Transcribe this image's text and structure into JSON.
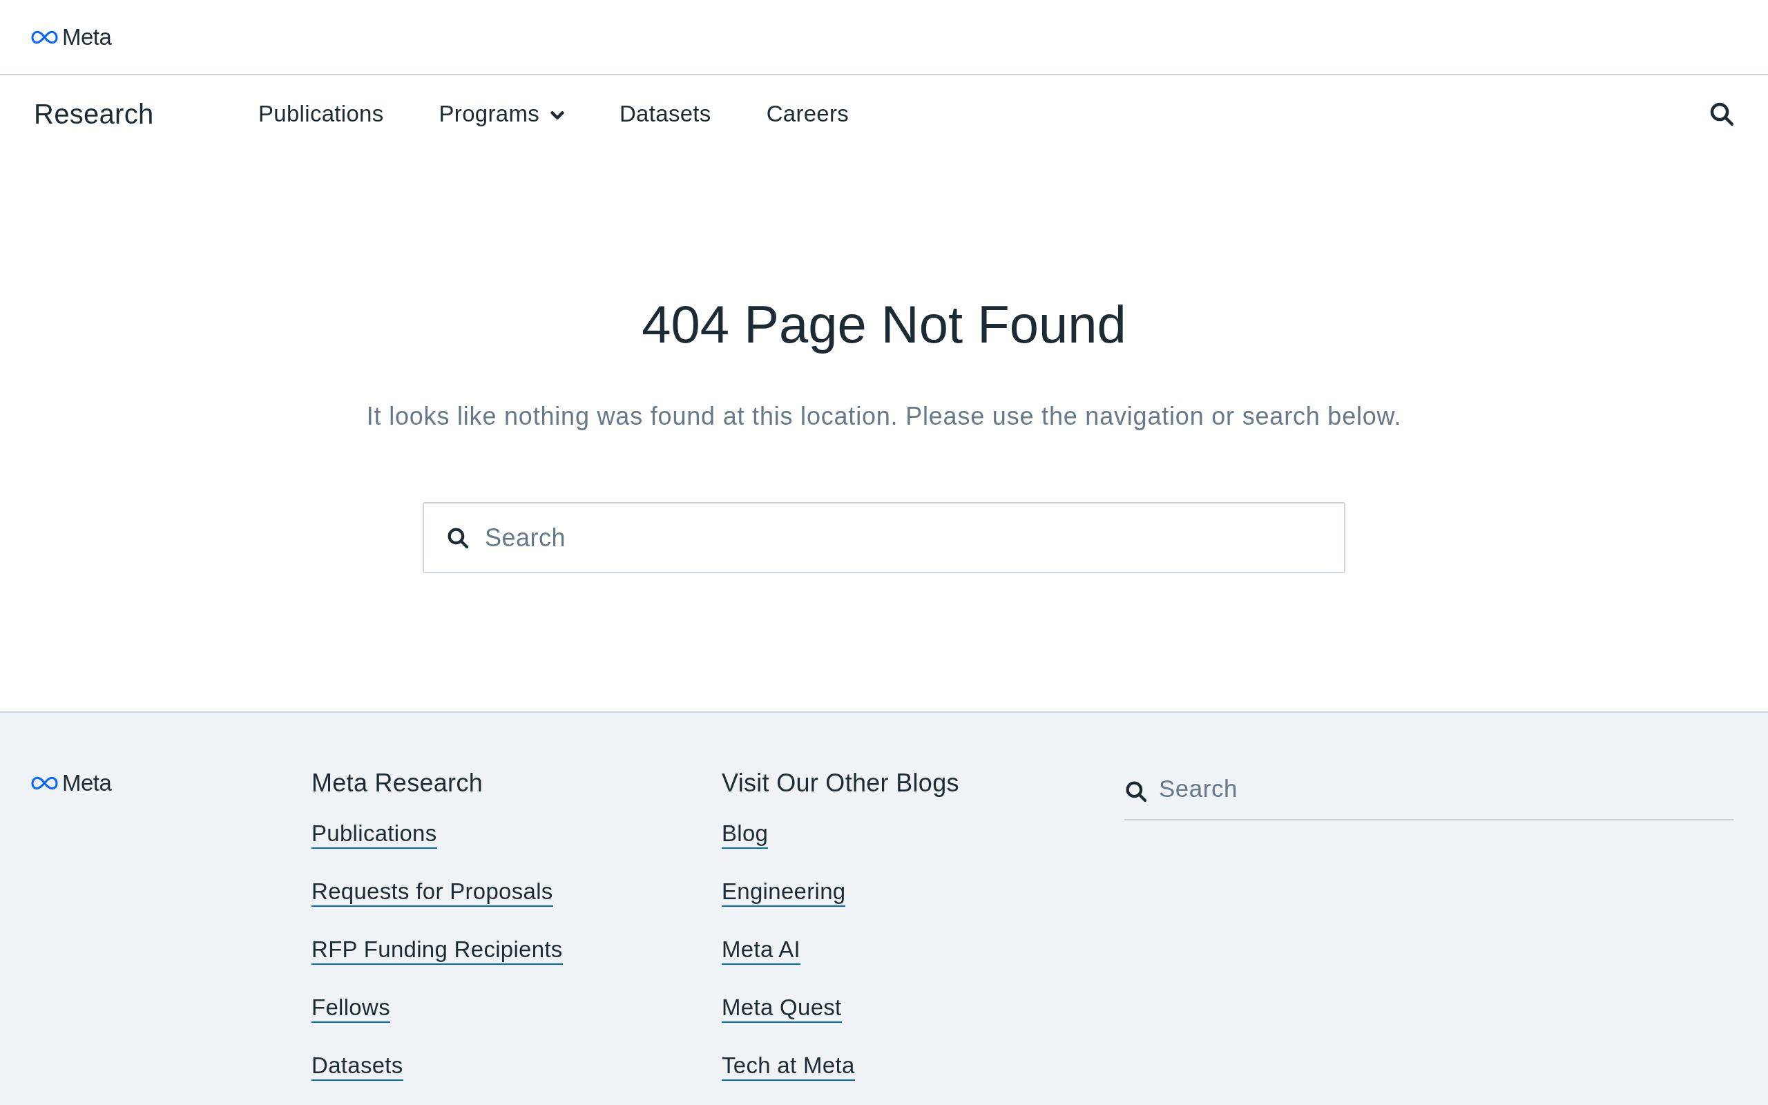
{
  "header": {
    "brand": {
      "wordmark": "Meta"
    }
  },
  "nav": {
    "title": "Research",
    "items": [
      {
        "label": "Publications",
        "kind": "link"
      },
      {
        "label": "Programs",
        "kind": "dropdown"
      },
      {
        "label": "Datasets",
        "kind": "link"
      },
      {
        "label": "Careers",
        "kind": "link"
      }
    ]
  },
  "main": {
    "heading": "404 Page Not Found",
    "message": "It looks like nothing was found at this location. Please use the navigation or search below.",
    "search": {
      "placeholder": "Search"
    }
  },
  "footer": {
    "brand": {
      "wordmark": "Meta"
    },
    "columns": [
      {
        "heading": "Meta Research",
        "links": [
          "Publications",
          "Requests for Proposals",
          "RFP Funding Recipients",
          "Fellows",
          "Datasets"
        ]
      },
      {
        "heading": "Visit Our Other Blogs",
        "links": [
          "Blog",
          "Engineering",
          "Meta AI",
          "Meta Quest",
          "Tech at Meta"
        ]
      }
    ],
    "search": {
      "placeholder": "Search"
    }
  }
}
